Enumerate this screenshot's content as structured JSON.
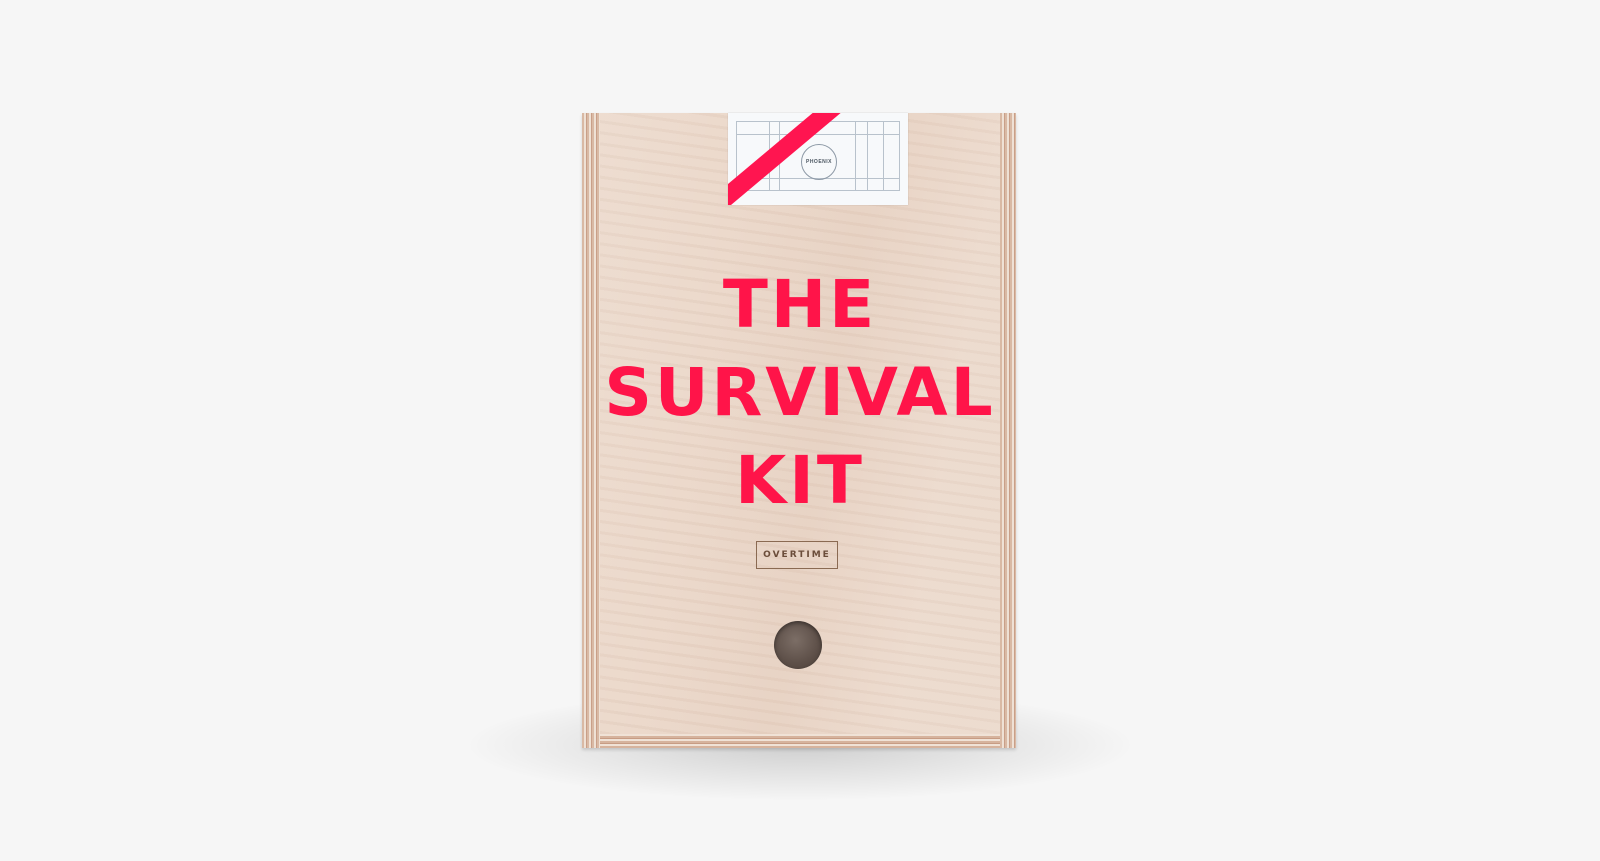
{
  "product": {
    "title_lines": [
      "THE",
      "SURVIVAL",
      "KIT"
    ],
    "badge": "OVERTIME",
    "label_brand": "PHOENIX"
  },
  "colors": {
    "title": "#ff1449",
    "tape": "#ff1550",
    "background": "#f6f6f6",
    "wood": "#ead7c9"
  }
}
